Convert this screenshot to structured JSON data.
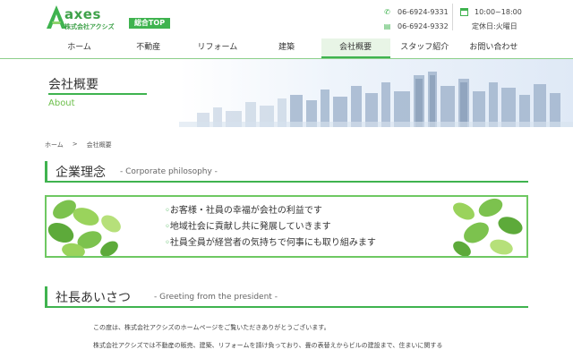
{
  "header": {
    "logo_word": "axes",
    "logo_sub": "株式会社アクシズ",
    "top_badge": "総合TOP",
    "phone1": "06-6924-9331",
    "phone2": "06-6924-9332",
    "hours": "10:00~18:00",
    "holiday": "定休日:火曜日"
  },
  "nav": {
    "items": [
      "ホーム",
      "不動産",
      "リフォーム",
      "建築",
      "会社概要",
      "スタッフ紹介",
      "お問い合わせ"
    ],
    "active_index": 4
  },
  "hero": {
    "title": "会社概要",
    "subtitle": "About"
  },
  "breadcrumb": {
    "home": "ホーム",
    "separator": ">",
    "current": "会社概要"
  },
  "philosophy": {
    "title": "企業理念",
    "en": "- Corporate philosophy -",
    "bullet": "◦",
    "items": [
      "お客様・社員の幸福が会社の利益です",
      "地域社会に貢献し共に発展していきます",
      "社員全員が経営者の気持ちで何事にも取り組みます"
    ]
  },
  "greeting": {
    "title": "社長あいさつ",
    "en": "- Greeting from the president -",
    "para1": "この度は、株式会社アクシズのホームページをご覧いただきありがとうございます。",
    "para2": "株式会社アクシズでは不動産の販売、建築、リフォームを請け負っており、畳の表替えからビルの建設まで、住まいに関する"
  },
  "colors": {
    "accent": "#3fb34f",
    "accent_light": "#6ec862"
  }
}
